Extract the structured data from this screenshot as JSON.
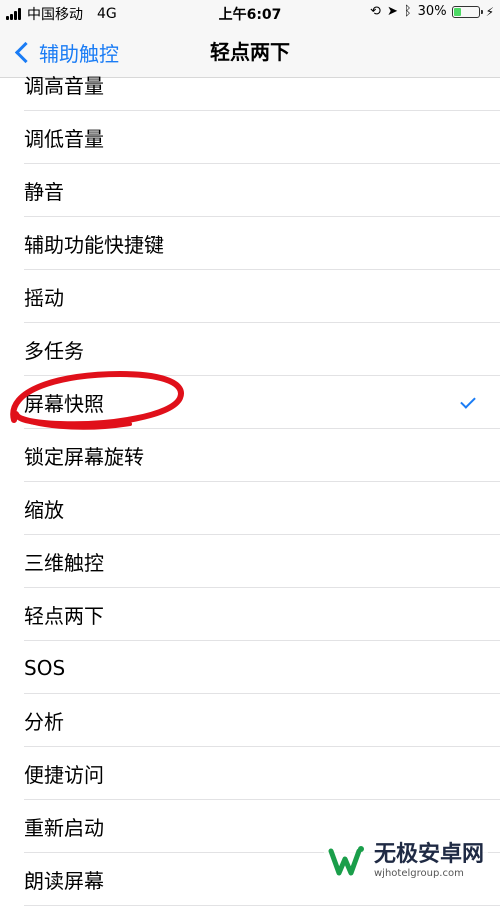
{
  "status_bar": {
    "carrier": "中国移动",
    "network": "4G",
    "time": "上午6:07",
    "battery_pct": "30%",
    "battery_level": 0.3,
    "icons": [
      "signal-icon",
      "lock-rotation-icon",
      "location-icon",
      "bluetooth-icon",
      "battery-icon",
      "charging-icon"
    ]
  },
  "nav": {
    "back_label": "辅助触控",
    "title": "轻点两下"
  },
  "list": {
    "items": [
      {
        "label": "调高音量",
        "selected": false
      },
      {
        "label": "调低音量",
        "selected": false
      },
      {
        "label": "静音",
        "selected": false
      },
      {
        "label": "辅助功能快捷键",
        "selected": false
      },
      {
        "label": "摇动",
        "selected": false
      },
      {
        "label": "多任务",
        "selected": false
      },
      {
        "label": "屏幕快照",
        "selected": true
      },
      {
        "label": "锁定屏幕旋转",
        "selected": false
      },
      {
        "label": "缩放",
        "selected": false
      },
      {
        "label": "三维触控",
        "selected": false
      },
      {
        "label": "轻点两下",
        "selected": false
      },
      {
        "label": "SOS",
        "selected": false
      },
      {
        "label": "分析",
        "selected": false
      },
      {
        "label": "便捷访问",
        "selected": false
      },
      {
        "label": "重新启动",
        "selected": false
      },
      {
        "label": "朗读屏幕",
        "selected": false
      }
    ]
  },
  "colors": {
    "accent": "#1a7cf5",
    "annotation": "#e0101a",
    "battery_fill": "#4cd964"
  },
  "watermark": {
    "title": "无极安卓网",
    "url": "wjhotelgroup.com"
  }
}
